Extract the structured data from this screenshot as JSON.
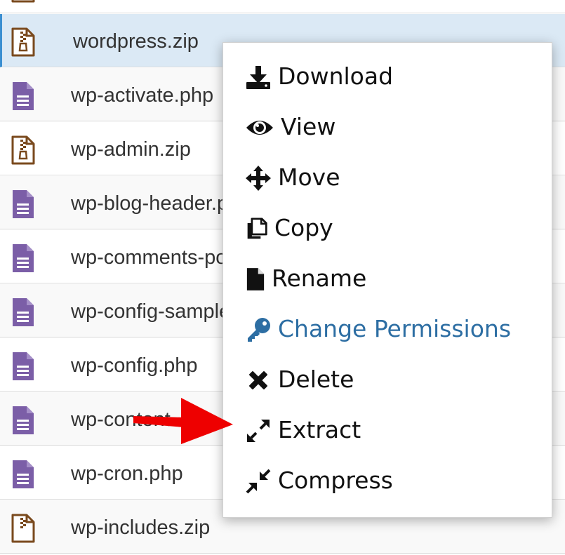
{
  "files": [
    {
      "name": "",
      "type": "zip"
    },
    {
      "name": "wordpress.zip",
      "type": "zip",
      "selected": true
    },
    {
      "name": "wp-activate.php",
      "type": "php"
    },
    {
      "name": "wp-admin.zip",
      "type": "zip"
    },
    {
      "name": "wp-blog-header.php",
      "type": "php"
    },
    {
      "name": "wp-comments-post.php",
      "type": "php"
    },
    {
      "name": "wp-config-sample.php",
      "type": "php"
    },
    {
      "name": "wp-config.php",
      "type": "php"
    },
    {
      "name": "wp-content",
      "type": "php"
    },
    {
      "name": "wp-cron.php",
      "type": "php"
    },
    {
      "name": "wp-includes.zip",
      "type": "zip"
    }
  ],
  "context_menu": {
    "items": [
      {
        "label": "Download",
        "icon": "download-icon"
      },
      {
        "label": "View",
        "icon": "eye-icon"
      },
      {
        "label": "Move",
        "icon": "move-icon"
      },
      {
        "label": "Copy",
        "icon": "copy-icon"
      },
      {
        "label": "Rename",
        "icon": "file-icon"
      },
      {
        "label": "Change Permissions",
        "icon": "key-icon",
        "accent": true
      },
      {
        "label": "Delete",
        "icon": "close-icon"
      },
      {
        "label": "Extract",
        "icon": "expand-icon"
      },
      {
        "label": "Compress",
        "icon": "compress-icon"
      }
    ]
  },
  "annotation": {
    "arrow_color": "#ee0000",
    "arrow_target": "Extract"
  },
  "colors": {
    "php_icon": "#7b5ea7",
    "zip_icon": "#7a4a1e",
    "selected_row": "#dbe9f5",
    "accent_text": "#2d6ea3"
  }
}
